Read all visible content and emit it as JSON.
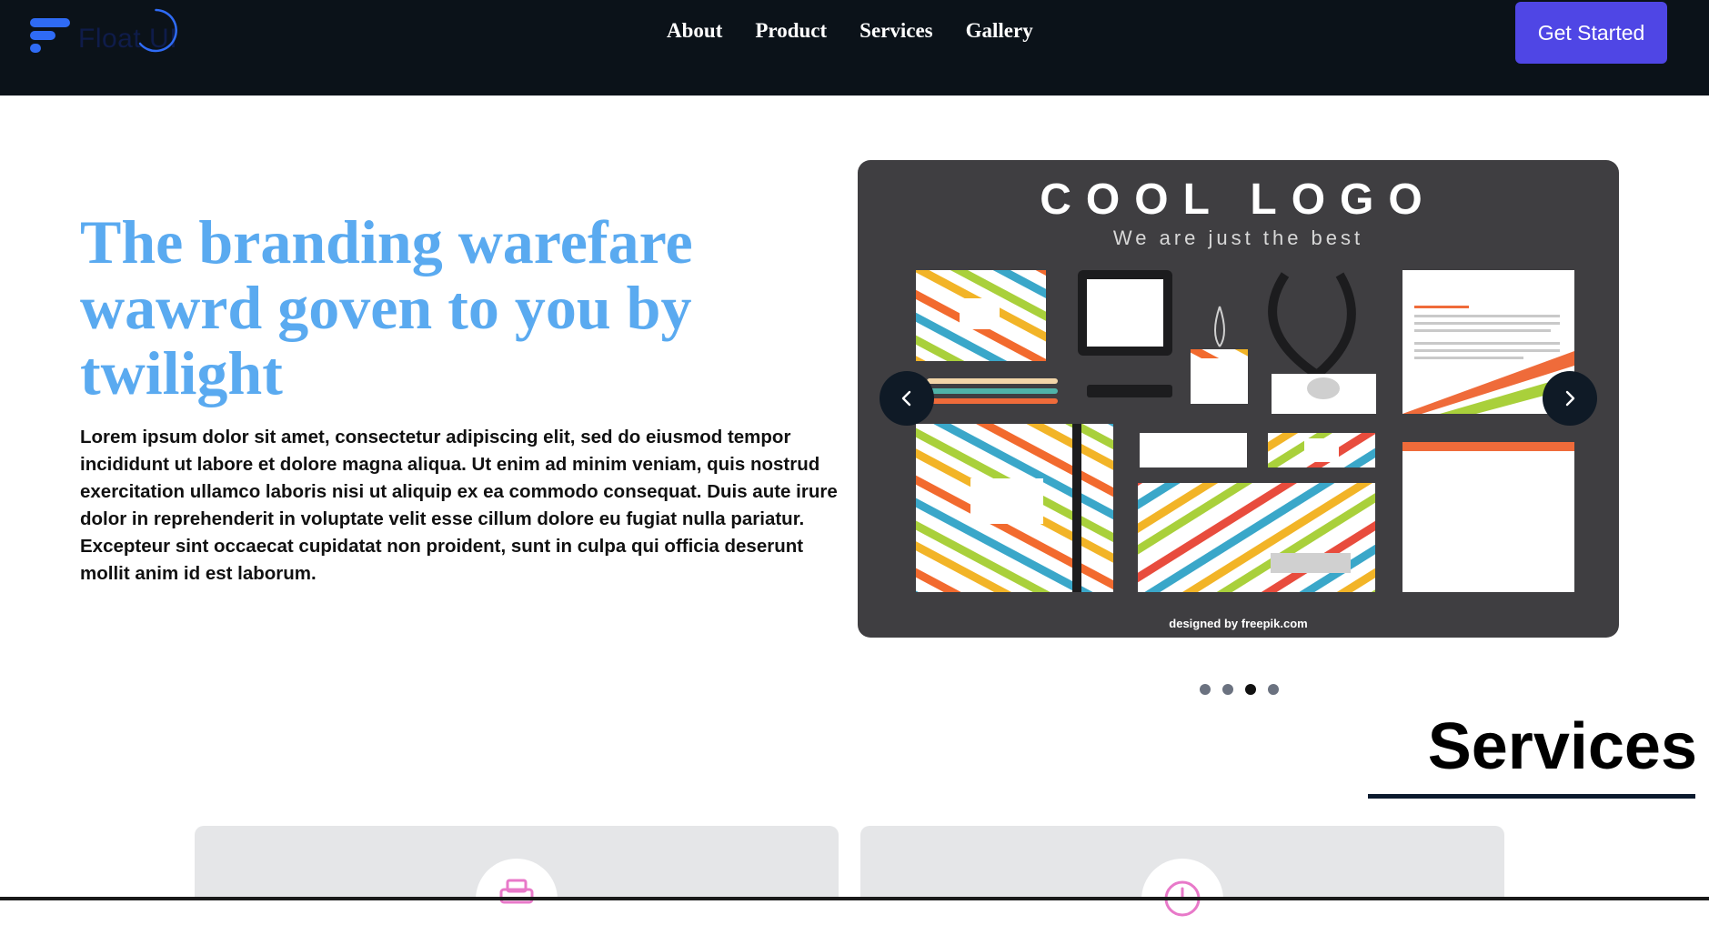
{
  "nav": {
    "logo_text": "Float UI",
    "menu": [
      "About",
      "Product",
      "Services",
      "Gallery"
    ],
    "cta_label": "Get Started"
  },
  "hero": {
    "title": "The branding warefare wawrd goven to you by twilight",
    "body": "Lorem ipsum dolor sit amet, consectetur adipiscing elit, sed do eiusmod tempor incididunt ut labore et dolore magna aliqua. Ut enim ad minim veniam, quis nostrud exercitation ullamco laboris nisi ut aliquip ex ea commodo consequat. Duis aute irure dolor in reprehenderit in voluptate velit esse cillum dolore eu fugiat nulla pariatur. Excepteur sint occaecat cupidatat non proident, sunt in culpa qui officia deserunt mollit anim id est laborum."
  },
  "carousel": {
    "art_title": "COOL LOGO",
    "art_subtitle": "We are just the best",
    "art_credit": "designed by freepik.com",
    "icons": {
      "prev": "chevron-left-icon",
      "next": "chevron-right-icon"
    },
    "slide_count": 4,
    "active_index": 2
  },
  "services": {
    "title": "Services",
    "cards": [
      {
        "icon": "printer-icon",
        "icon_color": "#e879c9"
      },
      {
        "icon": "clock-icon",
        "icon_color": "#e879c9"
      }
    ]
  },
  "colors": {
    "nav_bg": "#0b1219",
    "accent": "#4f46e5",
    "hero_title": "#5aaaf0",
    "logo_blue": "#2563eb"
  }
}
